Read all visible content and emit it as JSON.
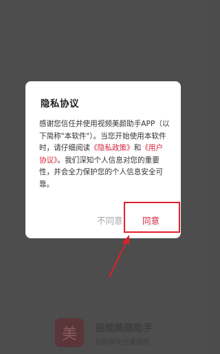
{
  "dialog": {
    "title": "隐私协议",
    "body_intro": "感谢您信任并使用视频美颜助手APP（以下简称\"本软件\"）。当您开始使用本软件时，请仔细阅读",
    "privacy_link": "《隐私政策》",
    "and_text": "和",
    "user_agreement_link": "《用户协议》",
    "body_outro": "。我们深知个人信息对您的重要性，并会全力保护您的个人信息安全可靠。",
    "decline_label": "不同意",
    "agree_label": "同意"
  },
  "brand": {
    "icon_char": "美",
    "name": "视频美颜助手",
    "slogan": "视频聊天也美颜啦"
  },
  "colors": {
    "accent": "#d2233a",
    "highlight": "#e0202b",
    "overlay": "#4d4d4d"
  }
}
